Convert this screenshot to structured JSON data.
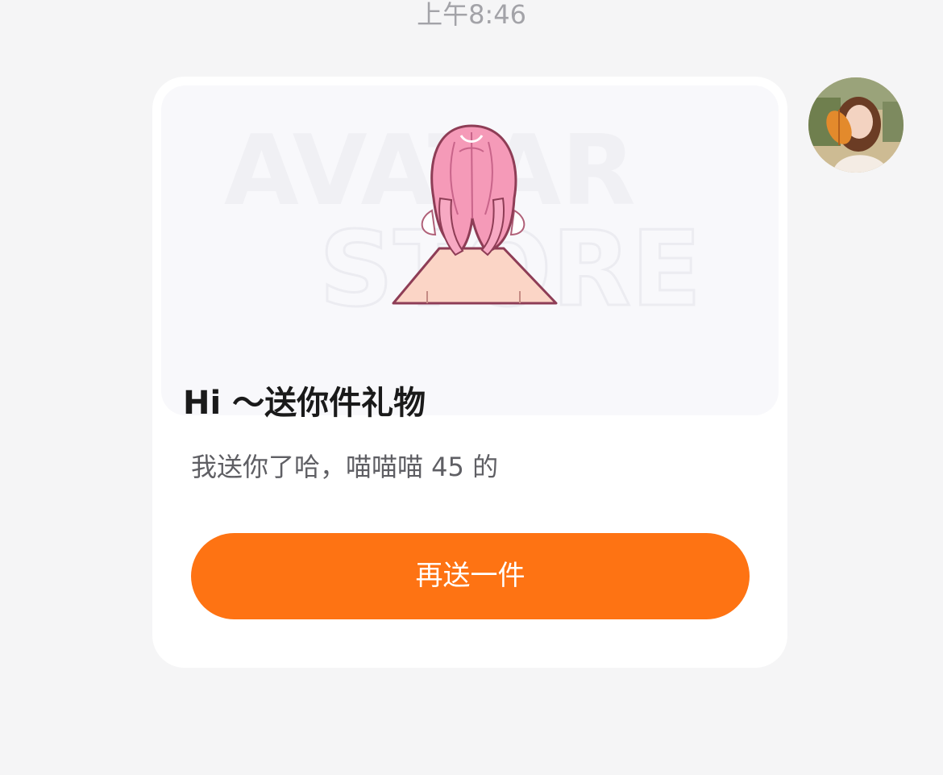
{
  "chat": {
    "timestamp": "上午8:46"
  },
  "gift_card": {
    "watermark_line1": "AVATAR",
    "watermark_line2": "STORE",
    "title": "Hi ～送你件礼物",
    "message": "我送你了哈，喵喵喵 45 的",
    "resend_label": "再送一件"
  },
  "colors": {
    "background": "#f5f5f6",
    "card": "#ffffff",
    "accent_button": "#fe7313",
    "hair_pink": "#f59ab8",
    "skin": "#fbd5c6"
  },
  "icons": {
    "avatar_figure": "character-back-hair-figure",
    "sender_avatar": "user-avatar-photo"
  }
}
